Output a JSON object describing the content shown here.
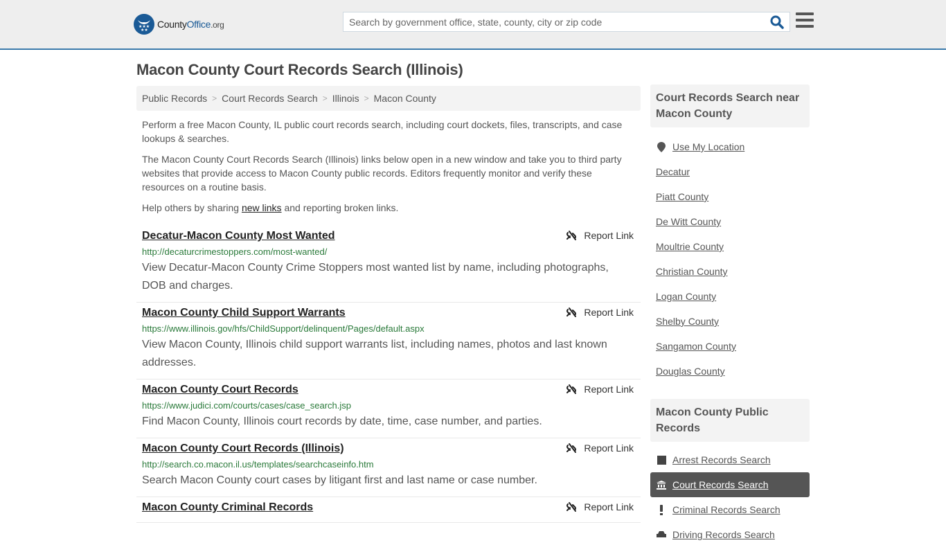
{
  "header": {
    "logo": {
      "name": "County",
      "brand": "Office",
      "tld": ".org"
    },
    "search": {
      "placeholder": "Search by government office, state, county, city or zip code",
      "value": ""
    }
  },
  "page_title": "Macon County Court Records Search (Illinois)",
  "breadcrumb": [
    "Public Records",
    "Court Records Search",
    "Illinois",
    "Macon County"
  ],
  "intro": {
    "p1": "Perform a free Macon County, IL public court records search, including court dockets, files, transcripts, and case lookups & searches.",
    "p2": "The Macon County Court Records Search (Illinois) links below open in a new window and take you to third party websites that provide access to Macon County public records. Editors frequently monitor and verify these resources on a routine basis.",
    "p3_before": "Help others by sharing ",
    "p3_link": "new links",
    "p3_after": " and reporting broken links."
  },
  "report_label": "Report Link",
  "results": [
    {
      "title": "Decatur-Macon County Most Wanted",
      "url": "http://decaturcrimestoppers.com/most-wanted/",
      "desc": "View Decatur-Macon County Crime Stoppers most wanted list by name, including photographs, DOB and charges."
    },
    {
      "title": "Macon County Child Support Warrants",
      "url": "https://www.illinois.gov/hfs/ChildSupport/delinquent/Pages/default.aspx",
      "desc": "View Macon County, Illinois child support warrants list, including names, photos and last known addresses."
    },
    {
      "title": "Macon County Court Records",
      "url": "https://www.judici.com/courts/cases/case_search.jsp",
      "desc": "Find Macon County, Illinois court records by date, time, case number, and parties."
    },
    {
      "title": "Macon County Court Records (Illinois)",
      "url": "http://search.co.macon.il.us/templates/searchcaseinfo.htm",
      "desc": "Search Macon County court cases by litigant first and last name or case number."
    },
    {
      "title": "Macon County Criminal Records",
      "url": "",
      "desc": ""
    }
  ],
  "sidebar": {
    "nearby_title": "Court Records Search near Macon County",
    "use_location": "Use My Location",
    "nearby": [
      "Decatur",
      "Piatt County",
      "De Witt County",
      "Moultrie County",
      "Christian County",
      "Logan County",
      "Shelby County",
      "Sangamon County",
      "Douglas County"
    ],
    "public_title": "Macon County Public Records",
    "public": [
      {
        "label": "Arrest Records Search",
        "icon": "square-icon",
        "active": false
      },
      {
        "label": "Court Records Search",
        "icon": "courthouse-icon",
        "active": true
      },
      {
        "label": "Criminal Records Search",
        "icon": "exclamation-icon",
        "active": false
      },
      {
        "label": "Driving Records Search",
        "icon": "car-icon",
        "active": false
      }
    ]
  }
}
